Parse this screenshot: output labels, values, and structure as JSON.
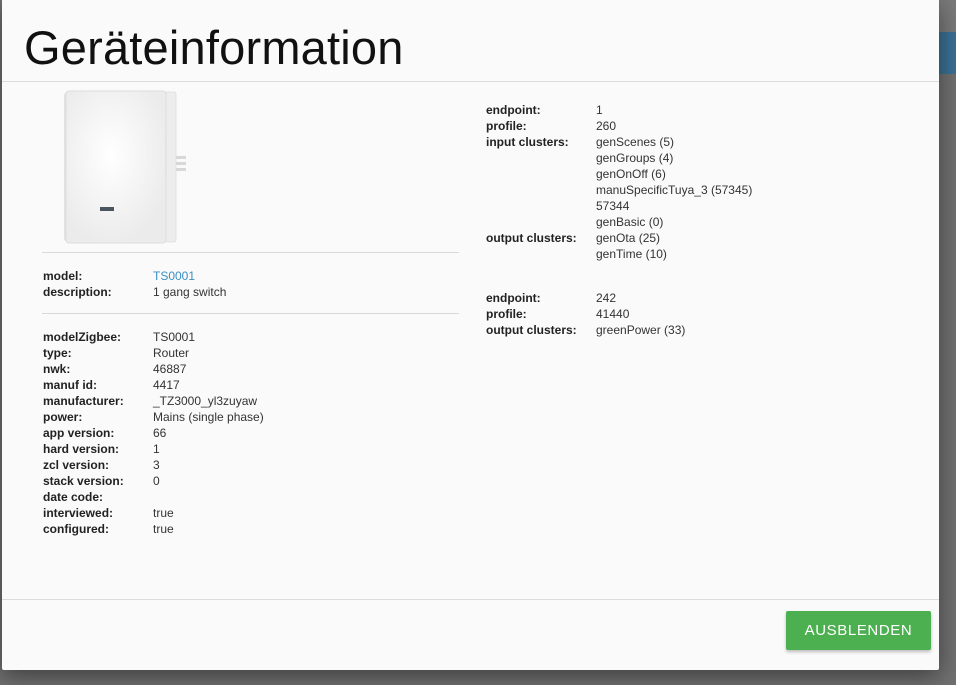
{
  "dialog": {
    "title": "Geräteinformation",
    "hide_button_label": "AUSBLENDEN",
    "accent_color": "#4caf50",
    "link_color": "#3a8fc4"
  },
  "model_info": [
    {
      "label": "model:",
      "value": "TS0001",
      "is_link": true
    },
    {
      "label": "description:",
      "value": "1 gang switch"
    }
  ],
  "details": [
    {
      "label": "modelZigbee:",
      "value": "TS0001"
    },
    {
      "label": "type:",
      "value": "Router"
    },
    {
      "label": "nwk:",
      "value": "46887"
    },
    {
      "label": "manuf id:",
      "value": "4417"
    },
    {
      "label": "manufacturer:",
      "value": "_TZ3000_yl3zuyaw"
    },
    {
      "label": "power:",
      "value": "Mains (single phase)"
    },
    {
      "label": "app version:",
      "value": "66"
    },
    {
      "label": "hard version:",
      "value": "1"
    },
    {
      "label": "zcl version:",
      "value": "3"
    },
    {
      "label": "stack version:",
      "value": "0"
    },
    {
      "label": "date code:",
      "value": ""
    },
    {
      "label": "interviewed:",
      "value": "true"
    },
    {
      "label": "configured:",
      "value": "true"
    }
  ],
  "endpoints": [
    {
      "endpoint_label": "endpoint:",
      "endpoint": "1",
      "profile_label": "profile:",
      "profile": "260",
      "input_label": "input clusters:",
      "input_clusters": [
        "genScenes (5)",
        "genGroups (4)",
        "genOnOff (6)",
        "manuSpecificTuya_3 (57345)",
        "57344",
        "genBasic (0)"
      ],
      "output_label": "output clusters:",
      "output_clusters": [
        "genOta (25)",
        "genTime (10)"
      ]
    },
    {
      "endpoint_label": "endpoint:",
      "endpoint": "242",
      "profile_label": "profile:",
      "profile": "41440",
      "output_label": "output clusters:",
      "output_clusters": [
        "greenPower (33)"
      ]
    }
  ]
}
